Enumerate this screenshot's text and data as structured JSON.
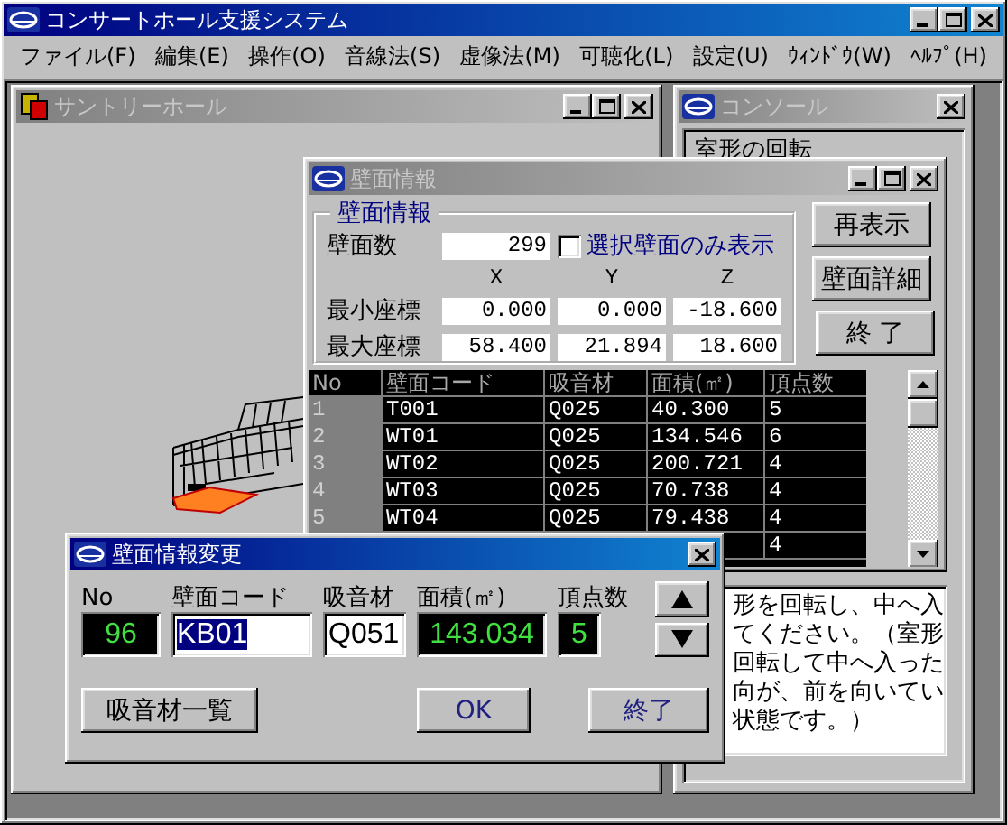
{
  "window": {
    "title": "コンサートホール支援システム",
    "active": true
  },
  "menu": [
    "ファイル(F)",
    "編集(E)",
    "操作(O)",
    "音線法(S)",
    "虚像法(M)",
    "可聴化(L)",
    "設定(U)",
    "ｳｨﾝﾄﾞｳ(W)",
    "ﾍﾙﾌﾟ(H)"
  ],
  "hall_window": {
    "title": "サントリーホール",
    "active": false
  },
  "console_window": {
    "title": "コンソール",
    "active": false,
    "heading": "室形の回転",
    "message_lines": [
      "形を回転し、中へ入",
      "てください。（室形",
      "回転して中へ入った",
      "向が、前を向いてい",
      "状態です。）"
    ]
  },
  "wall_info_window": {
    "title": "壁面情報",
    "active": false,
    "group_title": "壁面情報",
    "wall_count_label": "壁面数",
    "wall_count": "299",
    "selected_only": {
      "label": "選択壁面のみ表示",
      "checked": false
    },
    "axes": [
      "X",
      "Y",
      "Z"
    ],
    "coordinates": [
      {
        "label": "最小座標",
        "values": [
          "0.000",
          "0.000",
          "-18.600"
        ]
      },
      {
        "label": "最大座標",
        "values": [
          "58.400",
          "21.894",
          "18.600"
        ]
      }
    ],
    "buttons": [
      "再表示",
      "壁面詳細",
      "終 了"
    ],
    "table": {
      "columns": [
        "No",
        "壁面コード",
        "吸音材",
        "面積(㎡)",
        "頂点数"
      ],
      "rows": [
        [
          "1",
          "T001",
          "Q025",
          "40.300",
          "5"
        ],
        [
          "2",
          "WT01",
          "Q025",
          "134.546",
          "6"
        ],
        [
          "3",
          "WT02",
          "Q025",
          "200.721",
          "4"
        ],
        [
          "4",
          "WT03",
          "Q025",
          "70.738",
          "4"
        ],
        [
          "5",
          "WT04",
          "Q025",
          "79.438",
          "4"
        ],
        [
          null,
          null,
          null,
          null,
          "4"
        ]
      ]
    }
  },
  "edit_dialog": {
    "title": "壁面情報変更",
    "active": true,
    "fields": [
      {
        "label": "No",
        "value": "96",
        "kind": "readout"
      },
      {
        "label": "壁面コード",
        "value": "KB01",
        "kind": "input",
        "selected": true
      },
      {
        "label": "吸音材",
        "value": "Q051",
        "kind": "input",
        "selected": false
      },
      {
        "label": "面積(㎡)",
        "value": "143.034",
        "kind": "readout"
      },
      {
        "label": "頂点数",
        "value": "5",
        "kind": "readout"
      }
    ],
    "buttons": [
      "吸音材一覧",
      "OK",
      "終了"
    ]
  }
}
